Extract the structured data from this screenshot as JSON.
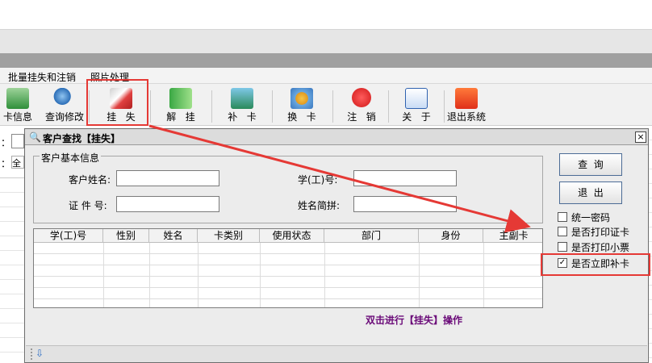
{
  "menubar": {
    "items": [
      "批量挂失和注销",
      "照片处理"
    ]
  },
  "toolbar": {
    "buttons": [
      {
        "label": "卡信息",
        "icon": "card-info-icon"
      },
      {
        "label": "查询修改",
        "icon": "magnifier-icon"
      },
      {
        "label": "挂   失",
        "icon": "report-loss-icon"
      },
      {
        "label": "解   挂",
        "icon": "unlock-arrow-icon"
      },
      {
        "label": "补   卡",
        "icon": "reissue-card-icon"
      },
      {
        "label": "换   卡",
        "icon": "swap-card-icon"
      },
      {
        "label": "注   销",
        "icon": "stop-sign-icon"
      },
      {
        "label": "关   于",
        "icon": "info-icon"
      },
      {
        "label": "退出系统",
        "icon": "exit-x-icon"
      }
    ]
  },
  "background": {
    "left_label_1": "：",
    "left_label_2": "：",
    "left_field_2": "全"
  },
  "dialog": {
    "title": "客户查找【挂失】",
    "close_label": "×",
    "group_title": "客户基本信息",
    "fields": {
      "name_label": "客户姓名:",
      "name_value": "",
      "studentno_label": "学(工)号:",
      "studentno_value": "",
      "idno_label": "证 件 号:",
      "idno_value": "",
      "pinyin_label": "姓名简拼:",
      "pinyin_value": ""
    },
    "buttons": {
      "search": "查  询",
      "exit": "退  出"
    },
    "checkboxes": [
      {
        "label": "统一密码",
        "checked": false,
        "mark": ""
      },
      {
        "label": "是否打印证卡",
        "checked": false,
        "mark": ""
      },
      {
        "label": "是否打印小票",
        "checked": false,
        "mark": ""
      },
      {
        "label": "是否立即补卡",
        "checked": true,
        "mark": "✓"
      }
    ],
    "grid": {
      "columns": [
        "学(工)号",
        "性别",
        "姓名",
        "卡类别",
        "使用状态",
        "部门",
        "身份",
        "主副卡"
      ]
    },
    "hint": "双击进行【挂失】操作"
  },
  "colors": {
    "annotation": "#e53935",
    "hint": "#6a0a78",
    "button_border": "#4c6c96"
  }
}
